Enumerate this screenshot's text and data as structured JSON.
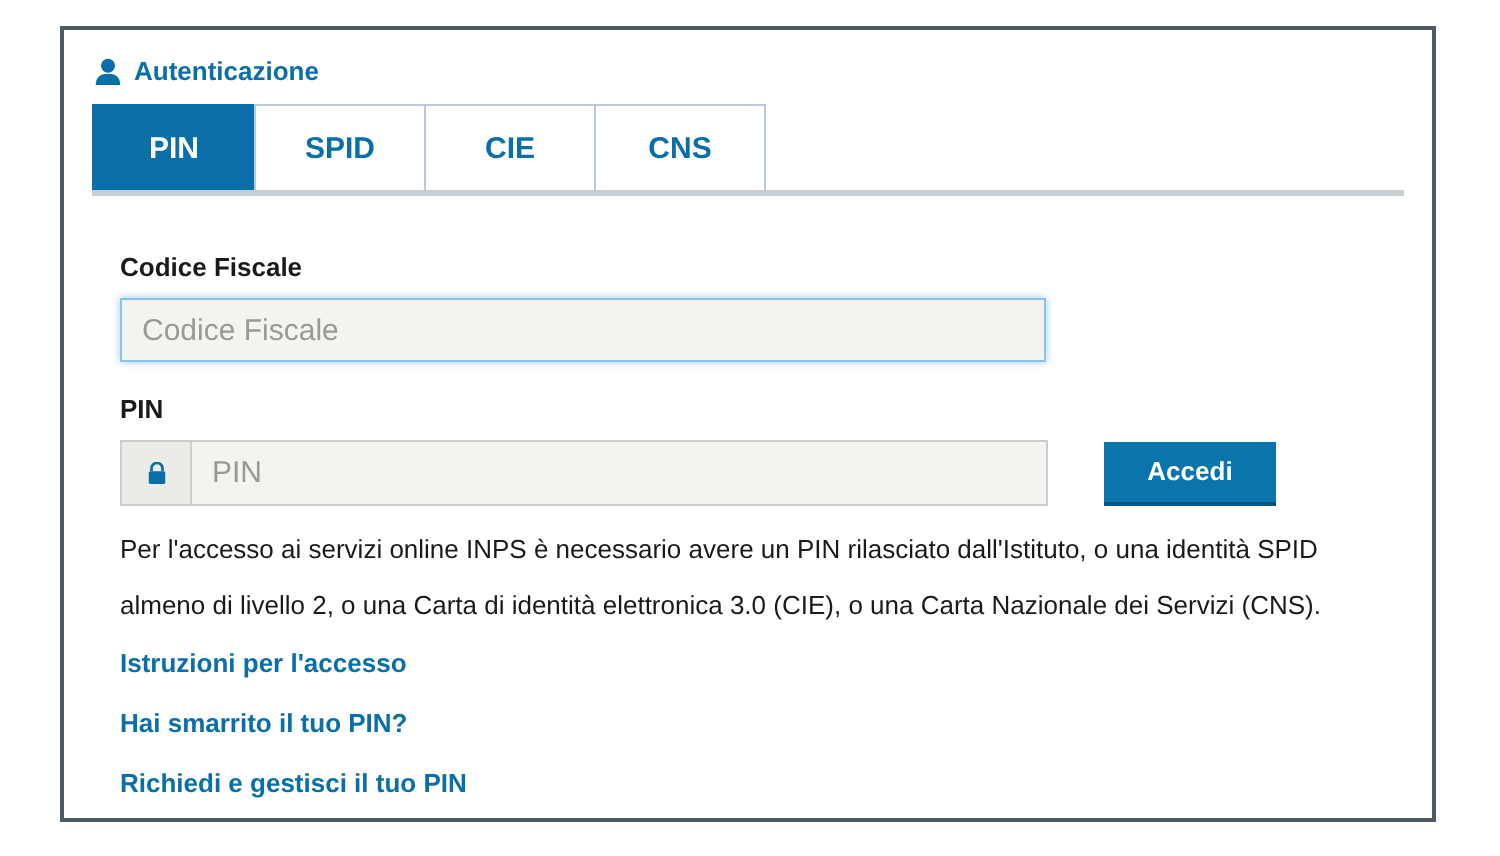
{
  "header": {
    "title": "Autenticazione"
  },
  "tabs": [
    {
      "label": "PIN",
      "selected": true
    },
    {
      "label": "SPID",
      "selected": false
    },
    {
      "label": "CIE",
      "selected": false
    },
    {
      "label": "CNS",
      "selected": false
    }
  ],
  "fields": [
    {
      "label": "Codice Fiscale",
      "placeholder": "Codice Fiscale",
      "focused": true,
      "kind": "plain"
    },
    {
      "label": "PIN",
      "placeholder": "PIN",
      "focused": false,
      "kind": "lock"
    }
  ],
  "submit": {
    "label": "Accedi"
  },
  "info": "Per l'accesso ai servizi online INPS è necessario avere un PIN rilasciato dall'Istituto, o una identità SPID almeno di livello 2, o una Carta di identità elettronica 3.0 (CIE), o una Carta Nazionale dei Servizi (CNS).",
  "links": [
    "Istruzioni per l'accesso",
    "Hai smarrito il tuo PIN?",
    "Richiedi e gestisci il tuo PIN"
  ]
}
